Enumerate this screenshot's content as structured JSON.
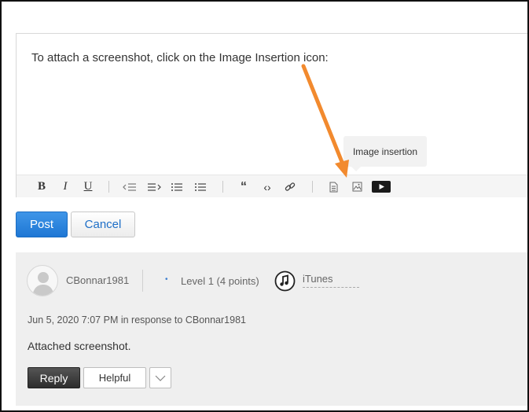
{
  "editor": {
    "text": "To attach a screenshot, click on the Image Insertion icon:",
    "tooltip": "Image insertion",
    "toolbar": {
      "bold": "B",
      "italic": "I",
      "underline": "U",
      "quote": "“",
      "code": "‹›",
      "icons": [
        "bold-icon",
        "italic-icon",
        "underline-icon",
        "outdent-icon",
        "indent-icon",
        "numbered-list-icon",
        "bulleted-list-icon",
        "quote-icon",
        "code-icon",
        "link-icon",
        "document-icon",
        "image-insertion-icon",
        "video-icon"
      ]
    },
    "annotation_color": "#f28a2e"
  },
  "actions": {
    "post_label": "Post",
    "cancel_label": "Cancel"
  },
  "reply": {
    "username": "CBonnar1981",
    "level": "Level 1",
    "points": "(4 points)",
    "community": "iTunes",
    "date": "Jun 5, 2020 7:07 PM in response to CBonnar1981",
    "body": "Attached screenshot.",
    "reply_label": "Reply",
    "helpful_label": "Helpful"
  },
  "colors": {
    "accent": "#1e77d4",
    "link": "#1e6fc7",
    "panel_bg": "#efefef"
  }
}
